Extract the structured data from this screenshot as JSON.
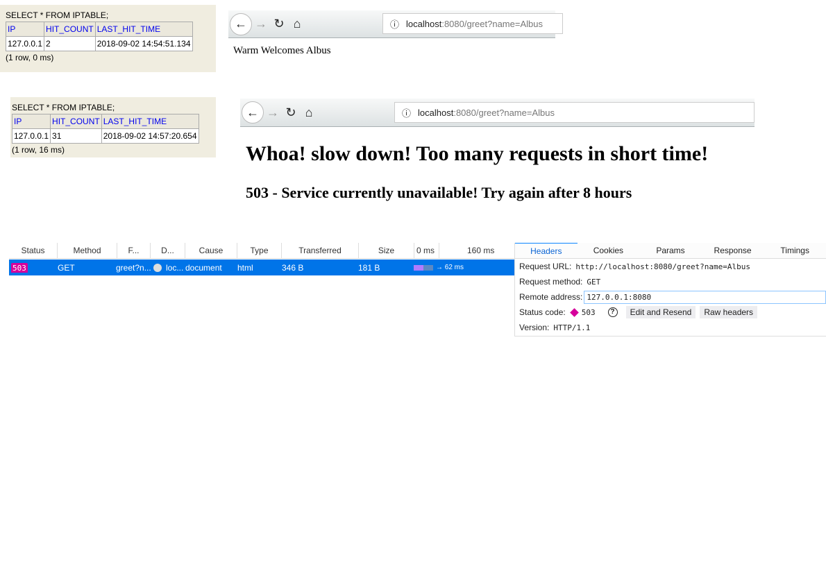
{
  "query_results": [
    {
      "query": "SELECT * FROM IPTABLE;",
      "columns": [
        "IP",
        "HIT_COUNT",
        "LAST_HIT_TIME"
      ],
      "rows": [
        [
          "127.0.0.1",
          "2",
          "2018-09-02 14:54:51.134"
        ]
      ],
      "summary": "(1 row, 0 ms)"
    },
    {
      "query": "SELECT * FROM IPTABLE;",
      "columns": [
        "IP",
        "HIT_COUNT",
        "LAST_HIT_TIME"
      ],
      "rows": [
        [
          "127.0.0.1",
          "31",
          "2018-09-02 14:57:20.654"
        ]
      ],
      "summary": "(1 row, 16 ms)"
    }
  ],
  "browser1": {
    "url_host": "localhost",
    "url_rest": ":8080/greet?name=Albus",
    "body": "Warm Welcomes Albus"
  },
  "browser2": {
    "url_host": "localhost",
    "url_rest": ":8080/greet?name=Albus",
    "heading": "Whoa! slow down! Too many requests in short time!",
    "subheading": "503 - Service currently unavailable! Try again after 8 hours"
  },
  "network": {
    "columns": [
      "Status",
      "Method",
      "F...",
      "D...",
      "Cause",
      "Type",
      "Transferred",
      "Size",
      "0 ms",
      "160 ms"
    ],
    "row": {
      "status": "503",
      "method": "GET",
      "file": "greet?n...",
      "domain": "loc...",
      "cause": "document",
      "type": "html",
      "transferred": "346 B",
      "size": "181 B",
      "timing": "→ 62 ms"
    },
    "status_color": "#d6009b"
  },
  "details": {
    "tabs": [
      "Headers",
      "Cookies",
      "Params",
      "Response",
      "Timings"
    ],
    "request_url_label": "Request URL:",
    "request_url": "http://localhost:8080/greet?name=Albus",
    "method_label": "Request method:",
    "method": "GET",
    "remote_label": "Remote address:",
    "remote": "127.0.0.1:8080",
    "status_label": "Status code:",
    "status": "503",
    "edit_resend": "Edit and Resend",
    "raw_headers": "Raw headers",
    "version_label": "Version:",
    "version": "HTTP/1.1"
  }
}
